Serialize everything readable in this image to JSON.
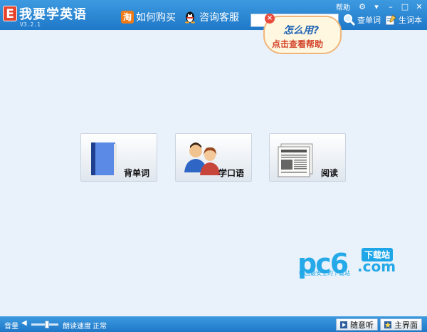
{
  "app": {
    "logo_letter": "E",
    "title": "我要学英语",
    "version": "V3.2.1"
  },
  "header": {
    "buy_label": "如何购买",
    "buy_icon_text": "淘",
    "service_label": "咨询客服",
    "help_link": "帮助",
    "lookup_label": "查单词",
    "wordbook_label": "生词本"
  },
  "search": {
    "value": ""
  },
  "help_bubble": {
    "line1": "怎么用?",
    "line2": "点击查看帮助",
    "close": "×"
  },
  "tiles": [
    {
      "label": "背单词",
      "icon": "book-icon"
    },
    {
      "label": "学口语",
      "icon": "people-icon"
    },
    {
      "label": "阅读",
      "icon": "newspaper-icon"
    }
  ],
  "watermark": {
    "brand": "pc6",
    "badge": "下载站",
    "domain": ".com",
    "slogan": "中国最安全的下载站"
  },
  "statusbar": {
    "volume_label": "音量",
    "speed_label": "朗读速度",
    "speed_value": "正常",
    "volume_level": 0.6,
    "random_listen": "随意听",
    "main_ui": "主界面"
  },
  "colors": {
    "titlebar": "#1f78c8",
    "background": "#e9f1fa",
    "accent": "#25a9e8"
  }
}
